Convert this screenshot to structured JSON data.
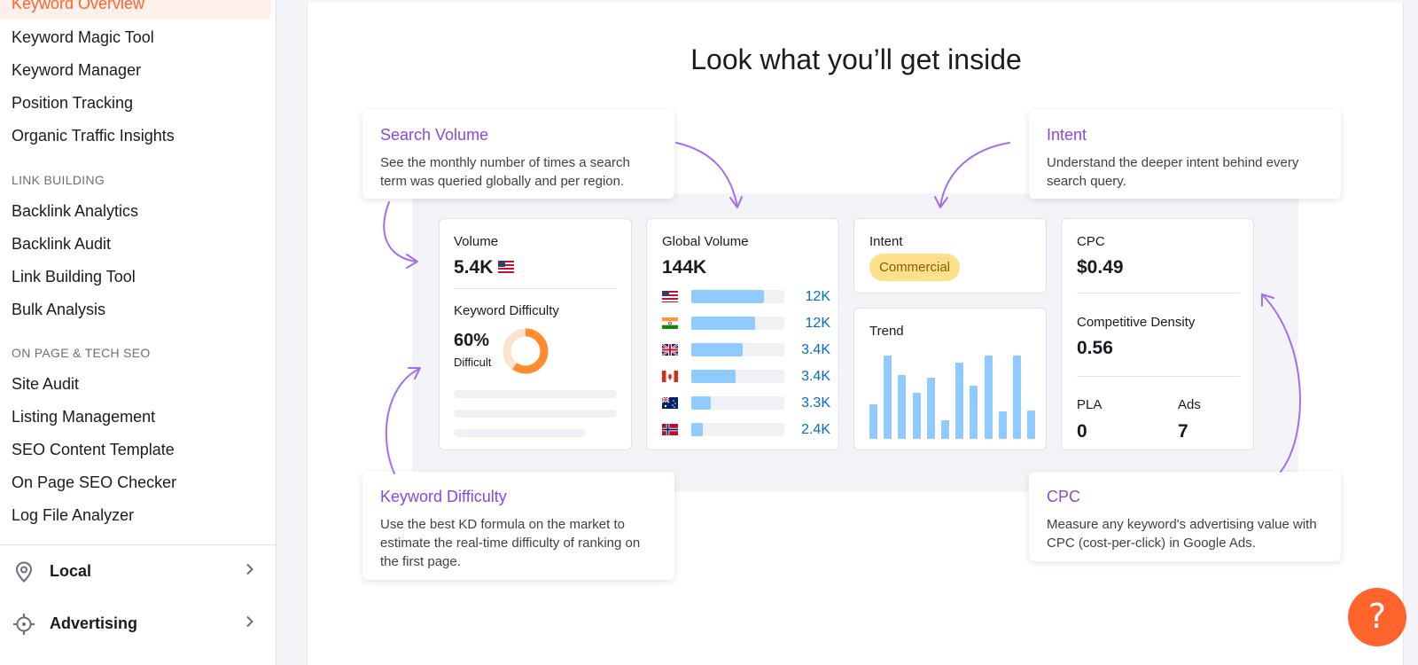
{
  "sidebar": {
    "active_item": "Keyword Overview",
    "items_top": [
      "Keyword Magic Tool",
      "Keyword Manager",
      "Position Tracking",
      "Organic Traffic Insights"
    ],
    "section_link_building": "LINK BUILDING",
    "items_link_building": [
      "Backlink Analytics",
      "Backlink Audit",
      "Link Building Tool",
      "Bulk Analysis"
    ],
    "section_on_page": "ON PAGE & TECH SEO",
    "items_on_page": [
      "Site Audit",
      "Listing Management",
      "SEO Content Template",
      "On Page SEO Checker",
      "Log File Analyzer"
    ],
    "groups": [
      {
        "label": "Local",
        "icon": "map-pin-icon"
      },
      {
        "label": "Advertising",
        "icon": "target-icon"
      }
    ]
  },
  "main": {
    "title": "Look what you’ll get inside",
    "callouts": {
      "search_volume": {
        "title": "Search Volume",
        "text": "See the monthly number of times a search term was queried globally and per region."
      },
      "intent": {
        "title": "Intent",
        "text": "Understand the deeper intent behind every search query."
      },
      "keyword_difficulty": {
        "title": "Keyword Difficulty",
        "text": "Use the best KD formula on the market to estimate the real-time difficulty of ranking on the first page."
      },
      "cpc": {
        "title": "CPC",
        "text": "Measure any keyword's advertising value with CPC (cost-per-click) in Google Ads."
      }
    },
    "volume_card": {
      "label": "Volume",
      "value": "5.4K",
      "flag": "us-flag-icon",
      "kd_label": "Keyword Difficulty",
      "kd_value": "60%",
      "kd_level": "Difficult",
      "kd_fraction": 0.6
    },
    "global_card": {
      "label": "Global Volume",
      "value": "144K",
      "rows": [
        {
          "flag": "us-flag-icon",
          "value": "12K",
          "fraction": 0.78
        },
        {
          "flag": "in-flag-icon",
          "value": "12K",
          "fraction": 0.69
        },
        {
          "flag": "uk-flag-icon",
          "value": "3.4K",
          "fraction": 0.55
        },
        {
          "flag": "ca-flag-icon",
          "value": "3.4K",
          "fraction": 0.48
        },
        {
          "flag": "au-flag-icon",
          "value": "3.3K",
          "fraction": 0.21
        },
        {
          "flag": "no-flag-icon",
          "value": "2.4K",
          "fraction": 0.12
        }
      ]
    },
    "intent_card": {
      "label": "Intent",
      "badge": "Commercial",
      "badge_color": "#ffe08a"
    },
    "trend_card": {
      "label": "Trend",
      "bars": [
        0.4,
        0.97,
        0.74,
        0.54,
        0.71,
        0.22,
        0.89,
        0.62,
        0.97,
        0.32,
        0.97,
        0.33
      ]
    },
    "cpc_card": {
      "label": "CPC",
      "value": "$0.49",
      "density_label": "Competitive Density",
      "density_value": "0.56",
      "pla_label": "PLA",
      "pla_value": "0",
      "ads_label": "Ads",
      "ads_value": "7"
    },
    "colors": {
      "accent": "#8649e1",
      "brand": "#ff642d",
      "bar": "#8fcbff",
      "link": "#006dca"
    }
  },
  "help": {
    "label": "?"
  }
}
